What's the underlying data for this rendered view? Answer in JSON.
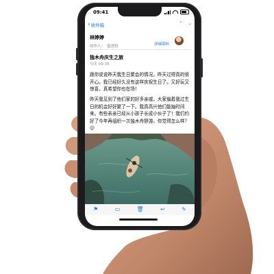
{
  "status": {
    "time": "09:41"
  },
  "nav": {
    "back_label": "收件箱"
  },
  "email": {
    "sender": "林婷婷",
    "recipient_label": "收件人：",
    "recipient_name": "曾进阳",
    "details_link": "详细资料",
    "subject": "独木舟庆生之旅",
    "date": "今天 09:35",
    "paragraph_1": "跟你说说昨天我生日聚会的情况。昨天过得真的很开心。我已经好久没有这样庆祝生日了。又好玩又惊喜，真希望你也在场！",
    "paragraph_2": "昨天我见到了他们家的好多亲戚，大家偏着我过生日的机会好好聚了一下。我真高兴他们能抽时间来。有些表亲已经从小孩子长成小伙子了！我们约好了今年再组织一次独木舟野游。你觉得怎么样？ 😊"
  },
  "toolbar": {
    "items": [
      "flag-icon",
      "folder-icon",
      "trash-icon",
      "reply-icon",
      "compose-icon"
    ]
  },
  "colors": {
    "accent": "#1a7cf5"
  }
}
